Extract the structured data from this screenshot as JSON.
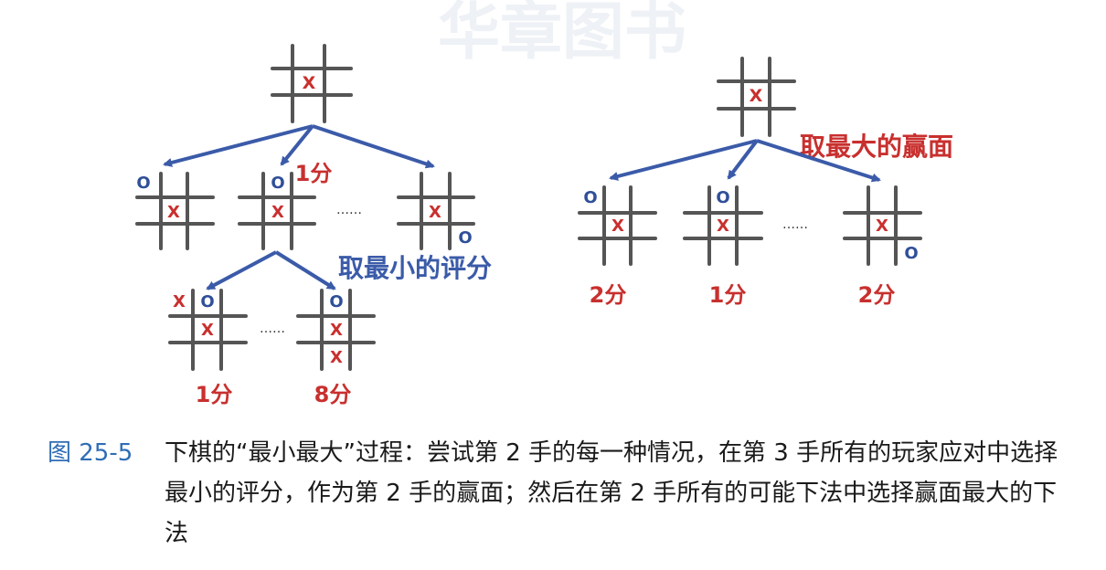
{
  "watermark": "华章图书",
  "left_tree": {
    "annotation": "取最小的评分",
    "score_upper": "1分",
    "dots": "……",
    "leaf_scores": [
      "1分",
      "8分"
    ]
  },
  "right_tree": {
    "annotation": "取最大的赢面",
    "dots": "……",
    "scores": [
      "2分",
      "1分",
      "2分"
    ]
  },
  "marks": {
    "x": "X",
    "o": "O"
  },
  "caption": {
    "label": "图 25-5",
    "text": "下棋的“最小最大”过程：尝试第 2 手的每一种情况，在第 3 手所有的玩家应对中选择最小的评分，作为第 2 手的赢面；然后在第 2 手所有的可能下法中选择赢面最大的下法"
  },
  "colors": {
    "grid": "#555555",
    "x_mark": "#c8302e",
    "o_mark": "#2f4f99",
    "arrow": "#3b5ba9",
    "score": "#c8302e",
    "annotation_min": "#3b5ba9",
    "annotation_max": "#c8302e",
    "caption_label": "#2f6db5"
  }
}
